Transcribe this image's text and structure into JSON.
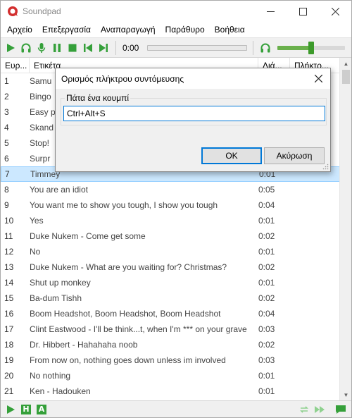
{
  "window": {
    "title": "Soundpad",
    "brand_color": "#d32f2f"
  },
  "menu": [
    "Αρχείο",
    "Επεξεργασία",
    "Αναπαραγωγή",
    "Παράθυρο",
    "Βοήθεια"
  ],
  "toolbar": {
    "time": "0:00",
    "volume_level": 0.5,
    "icons": [
      "play-icon",
      "headphones-icon",
      "microphone-icon",
      "pause-icon",
      "stop-icon",
      "previous-icon",
      "next-icon",
      "headphones-volume-icon"
    ],
    "accent": "#35a03a"
  },
  "table": {
    "columns": [
      "Ευρ...",
      "Ετικέτα",
      "Διά...",
      "Πλήκτρ..."
    ],
    "rows": [
      {
        "index": "1",
        "label": "Samu",
        "duration": ""
      },
      {
        "index": "2",
        "label": "Bingo",
        "duration": ""
      },
      {
        "index": "3",
        "label": "Easy p",
        "duration": ""
      },
      {
        "index": "4",
        "label": "Skand",
        "duration": ""
      },
      {
        "index": "5",
        "label": "Stop!",
        "duration": ""
      },
      {
        "index": "6",
        "label": "Surpr",
        "duration": ""
      },
      {
        "index": "7",
        "label": "Timmey",
        "duration": "0:01"
      },
      {
        "index": "8",
        "label": "You are an idiot",
        "duration": "0:05"
      },
      {
        "index": "9",
        "label": "You want me to show you tough, I show you tough",
        "duration": "0:04"
      },
      {
        "index": "10",
        "label": "Yes",
        "duration": "0:01"
      },
      {
        "index": "11",
        "label": "Duke Nukem - Come get some",
        "duration": "0:02"
      },
      {
        "index": "12",
        "label": "No",
        "duration": "0:01"
      },
      {
        "index": "13",
        "label": "Duke Nukem - What are you waiting for? Christmas?",
        "duration": "0:02"
      },
      {
        "index": "14",
        "label": "Shut up monkey",
        "duration": "0:01"
      },
      {
        "index": "15",
        "label": "Ba-dum Tishh",
        "duration": "0:02"
      },
      {
        "index": "16",
        "label": "Boom Headshot, Boom Headshot, Boom Headshot",
        "duration": "0:04"
      },
      {
        "index": "17",
        "label": "Clint Eastwood - I'll be think...t, when I'm *** on your grave",
        "duration": "0:03"
      },
      {
        "index": "18",
        "label": "Dr. Hibbert - Hahahaha noob",
        "duration": "0:02"
      },
      {
        "index": "19",
        "label": "From now on, nothing goes down unless im involved",
        "duration": "0:03"
      },
      {
        "index": "20",
        "label": "No nothing",
        "duration": "0:01"
      },
      {
        "index": "21",
        "label": "Ken - Hadouken",
        "duration": "0:01"
      }
    ],
    "selected_index": "7"
  },
  "statusbar": {
    "left_icons": [
      "play-icon",
      "h-icon",
      "a-icon"
    ],
    "h_letter": "H",
    "a_letter": "A",
    "right_icons": [
      "repeat-icon",
      "fast-forward-icon",
      "chat-icon"
    ]
  },
  "dialog": {
    "title": "Ορισμός πλήκτρου συντόμευσης",
    "group_label": "Πάτα ένα κουμπί",
    "input_value": "Ctrl+Alt+S",
    "ok_label": "OK",
    "cancel_label": "Ακύρωση"
  }
}
